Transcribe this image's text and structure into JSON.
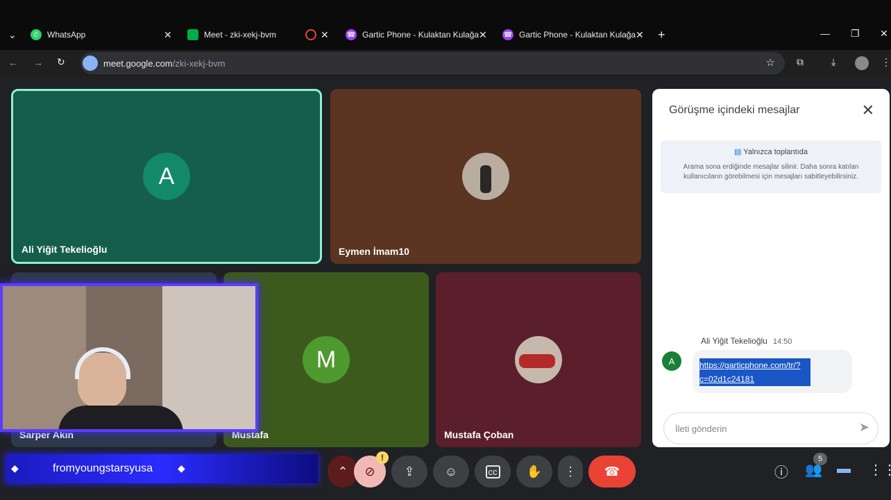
{
  "tabs": [
    {
      "title": "WhatsApp",
      "color": "#25d366"
    },
    {
      "title": "Meet - zki-xekj-bvm",
      "color": "#00ac47"
    },
    {
      "title": "",
      "color": "#ea4335"
    },
    {
      "title": "Gartic Phone - Kulaktan Kulağa",
      "color": "#a142f4"
    },
    {
      "title": "Gartic Phone - Kulaktan Kulağa",
      "color": "#a142f4"
    }
  ],
  "address": {
    "host": "meet.google.com",
    "path": "/zki-xekj-bvm"
  },
  "participants": [
    {
      "name": "Ali Yiğit Tekelioğlu",
      "initial": "A",
      "avatar_color": "#128a68",
      "bg": "#155e4c",
      "active": true
    },
    {
      "name": "Eymen İmam10",
      "initial": "",
      "avatar_color": "",
      "bg": "#5b3422",
      "active": false
    },
    {
      "name": "Sarper Akın",
      "initial": "",
      "avatar_color": "",
      "bg": "#2d3a4a",
      "active": false
    },
    {
      "name": "Mustafa",
      "initial": "M",
      "avatar_color": "#4f9a2f",
      "bg": "#3d5a1d",
      "active": false
    },
    {
      "name": "Mustafa Çoban",
      "initial": "",
      "avatar_color": "",
      "bg": "#5a1f2a",
      "active": false
    }
  ],
  "chat": {
    "title": "Görüşme içindeki mesajlar",
    "notice_title": "Yalnızca toplantıda",
    "notice_body": "Arama sona erdiğinde mesajlar silinir. Daha sonra katılan kullanıcıların görebilmesi için mesajları sabitleyebilirsiniz.",
    "message": {
      "sender": "Ali Yiğit Tekelioğlu",
      "time": "14:50",
      "initial": "A",
      "text": "https://garticphone.com/tr/?c=02d1c24181"
    },
    "compose_placeholder": "İleti gönderin"
  },
  "overlay": {
    "stream_name": "fromyoungstarsyusa"
  },
  "people_count": "5",
  "colors": {
    "accent_active": "#8ef0d4",
    "hangup": "#ea4335",
    "chat_icon": "#8ab4f8"
  }
}
